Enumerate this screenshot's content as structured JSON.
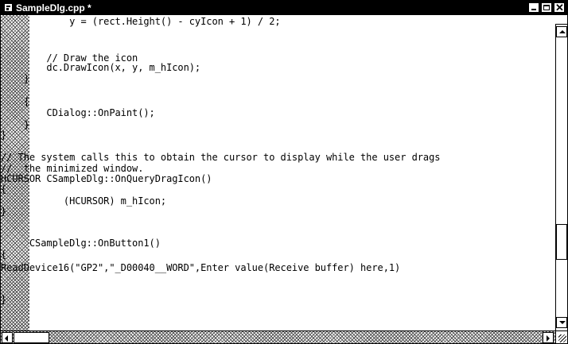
{
  "window": {
    "title": "SampleDlg.cpp *"
  },
  "editor": {
    "lines": [
      "            y = (rect.Height() - cyIcon + 1) / 2;",
      "",
      "        // Draw the icon",
      "        dc.DrawIcon(x, y, m_hIcon);",
      "    }",
      "",
      "    {",
      "        CDialog::OnPaint();",
      "    }",
      "}",
      "",
      "// The system calls this to obtain the cursor to display while the user drags",
      "//  the minimized window.",
      "HCURSOR CSampleDlg::OnQueryDragIcon()",
      "{",
      "           (HCURSOR) m_hIcon;",
      "}",
      "",
      "",
      "",
      "     CSampleDlg::OnButton1()",
      "{",
      "ReadDevice16(\"GP2\",\"_D00040__WORD\",Enter value(Receive buffer) here,1)",
      "",
      "",
      "}"
    ]
  }
}
